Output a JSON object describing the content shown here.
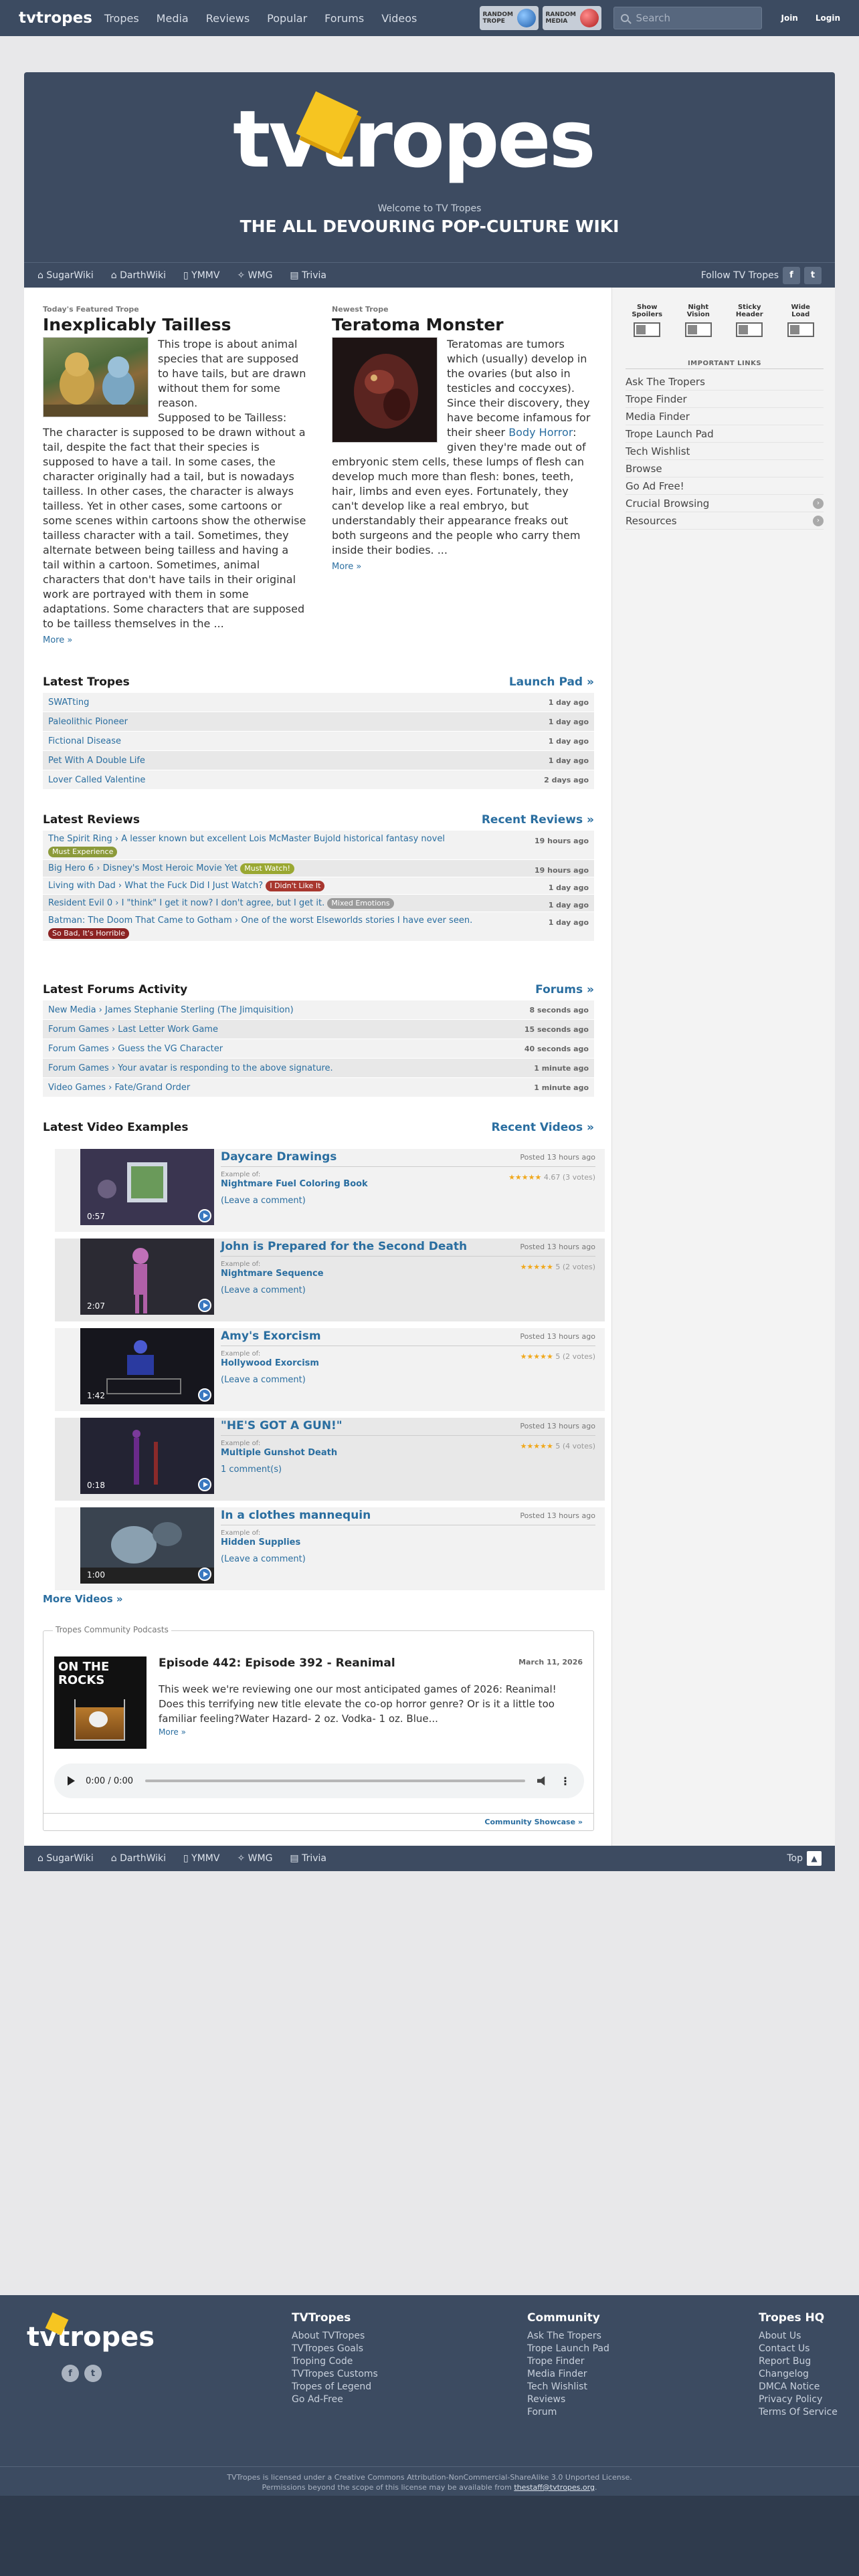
{
  "topbar": {
    "logo": "tvtropes",
    "nav": [
      "Tropes",
      "Media",
      "Reviews",
      "Popular",
      "Forums",
      "Videos"
    ],
    "random_trope": [
      "RANDOM",
      "TROPE"
    ],
    "random_media": [
      "RANDOM",
      "MEDIA"
    ],
    "search_placeholder": "Search",
    "join": "Join",
    "login": "Login"
  },
  "hero": {
    "logo": "tvtropes",
    "welcome": "Welcome to TV Tropes",
    "slogan": "THE ALL DEVOURING POP-CULTURE WIKI"
  },
  "subnav": {
    "items": [
      "SugarWiki",
      "DarthWiki",
      "YMMV",
      "WMG",
      "Trivia"
    ],
    "follow": "Follow TV Tropes"
  },
  "featured": {
    "label": "Today's Featured Trope",
    "title": "Inexplicably Tailless",
    "text": "This trope is about animal species that are supposed to have tails, but are drawn without them for some reason.\nSupposed to be Tailless: The character is supposed to be drawn without a tail, despite the fact that their species is supposed to have a tail. In some cases, the character originally had a tail, but is nowadays tailless. In other cases, the character is always tailless. Yet in other cases, some cartoons or some scenes within cartoons show the otherwise tailless character with a tail. Sometimes, they alternate between being tailless and having a tail within a cartoon. Sometimes, animal characters that don't have tails in their original work are portrayed with them in some adaptations. Some characters that are supposed to be tailless themselves in the ...",
    "more": "More »"
  },
  "newest": {
    "label": "Newest Trope",
    "title": "Teratoma Monster",
    "text_before": "Teratomas are tumors which (usually) develop in the ovaries (but also in testicles and coccyxes). Since their discovery, they have become infamous for their sheer ",
    "link": "Body Horror",
    "text_after": ": given they're made out of embryonic stem cells, these lumps of flesh can develop much more than flesh: bones, teeth, hair, limbs and even eyes. Fortunately, they can't develop like a real embryo, but understandably their appearance freaks out both surgeons and the people who carry them inside their bodies. ...",
    "more": "More »"
  },
  "latest_tropes": {
    "heading": "Latest Tropes",
    "link": "Launch Pad »",
    "rows": [
      {
        "name": "SWATting",
        "time": "1 day ago"
      },
      {
        "name": "Paleolithic Pioneer",
        "time": "1 day ago"
      },
      {
        "name": "Fictional Disease",
        "time": "1 day ago"
      },
      {
        "name": "Pet With A Double Life",
        "time": "1 day ago"
      },
      {
        "name": "Lover Called Valentine",
        "time": "2 days ago"
      }
    ]
  },
  "latest_reviews": {
    "heading": "Latest Reviews",
    "link": "Recent Reviews »",
    "rows": [
      {
        "work": "The Spirit Ring ›",
        "title": "A lesser known but excellent Lois McMaster Bujold historical fantasy novel",
        "tag": "Must Experience",
        "tag_color": "#8c9a3a",
        "time": "19 hours ago"
      },
      {
        "work": "Big Hero 6 ›",
        "title": "Disney's Most Heroic Movie Yet",
        "tag": "Must Watch!",
        "tag_color": "#9aa832",
        "time": "19 hours ago"
      },
      {
        "work": "Living with Dad ›",
        "title": "What the Fuck Did I Just Watch?",
        "tag": "I Didn't Like It",
        "tag_color": "#a8372f",
        "time": "1 day ago"
      },
      {
        "work": "Resident Evil 0 ›",
        "title": "I \"think\" I get it now? I don't agree, but I get it.",
        "tag": "Mixed Emotions",
        "tag_color": "#9a9a9a",
        "time": "1 day ago"
      },
      {
        "work": "Batman: The Doom That Came to Gotham ›",
        "title": "One of the worst Elseworlds stories I have ever seen.",
        "tag": "So Bad, It's Horrible",
        "tag_color": "#8c2323",
        "time": "1 day ago"
      }
    ]
  },
  "latest_forums": {
    "heading": "Latest Forums Activity",
    "link": "Forums »",
    "rows": [
      {
        "forum": "New Media ›",
        "topic": "James Stephanie Sterling (The Jimquisition)",
        "time": "8 seconds ago"
      },
      {
        "forum": "Forum Games ›",
        "topic": "Last Letter Work Game",
        "time": "15 seconds ago"
      },
      {
        "forum": "Forum Games ›",
        "topic": "Guess the VG Character",
        "time": "40 seconds ago"
      },
      {
        "forum": "Forum Games ›",
        "topic": "Your avatar is responding to the above signature.",
        "time": "1 minute ago"
      },
      {
        "forum": "Video Games ›",
        "topic": "Fate/Grand Order",
        "time": "1 minute ago"
      }
    ]
  },
  "latest_videos": {
    "heading": "Latest Video Examples",
    "link": "Recent Videos »",
    "example_of": "Example of:",
    "items": [
      {
        "title": "Daycare Drawings",
        "posted": "Posted 13 hours ago",
        "duration": "0:57",
        "trope": "Nightmare Fuel Coloring Book",
        "rating": "4.67 (3 votes)",
        "comments": "(Leave a comment)",
        "thumb_color": "#3a3550"
      },
      {
        "title": "John is Prepared for the Second Death",
        "posted": "Posted 13 hours ago",
        "duration": "2:07",
        "trope": "Nightmare Sequence",
        "rating": "5 (2 votes)",
        "comments": "(Leave a comment)",
        "thumb_color": "#2b2a33"
      },
      {
        "title": "Amy's Exorcism",
        "posted": "Posted 13 hours ago",
        "duration": "1:42",
        "trope": "Hollywood Exorcism",
        "rating": "5 (2 votes)",
        "comments": "(Leave a comment)",
        "thumb_color": "#16161d"
      },
      {
        "title": "\"HE'S GOT A GUN!\"",
        "posted": "Posted 13 hours ago",
        "duration": "0:18",
        "trope": "Multiple Gunshot Death",
        "rating": "5 (4 votes)",
        "comments": "1 comment(s)",
        "thumb_color": "#232333"
      },
      {
        "title": "In a clothes mannequin",
        "posted": "Posted 13 hours ago",
        "duration": "1:00",
        "trope": "Hidden Supplies",
        "rating": "",
        "comments": "(Leave a comment)",
        "thumb_color": "#3a4450"
      }
    ],
    "more": "More Videos »"
  },
  "podcast": {
    "section": "Tropes Community Podcasts",
    "art_text": "ON THE ROCKS",
    "episode": "Episode 442: Episode 392 - Reanimal",
    "date": "March 11, 2026",
    "desc": "This week we're reviewing one our most anticipated games of 2026: Reanimal! Does this terrifying new title elevate the co-op horror genre? Or is it a little too familiar feeling?Water Hazard- 2 oz. Vodka- 1 oz. Blue...",
    "more": "More »",
    "time": "0:00 / 0:00",
    "showcase": "Community Showcase »"
  },
  "sidebar": {
    "toggles": [
      {
        "label1": "Show",
        "label2": "Spoilers"
      },
      {
        "label1": "Night",
        "label2": "Vision"
      },
      {
        "label1": "Sticky",
        "label2": "Header"
      },
      {
        "label1": "Wide",
        "label2": "Load"
      }
    ],
    "important_heading": "IMPORTANT LINKS",
    "links": [
      "Ask The Tropers",
      "Trope Finder",
      "Media Finder",
      "Trope Launch Pad",
      "Tech Wishlist",
      "Browse",
      "Go Ad Free!",
      "Crucial Browsing",
      "Resources"
    ]
  },
  "bottom_nav": {
    "items": [
      "SugarWiki",
      "DarthWiki",
      "YMMV",
      "WMG",
      "Trivia"
    ],
    "top": "Top"
  },
  "footer": {
    "logo": "tvtropes",
    "social": [
      "f",
      "t"
    ],
    "cols": [
      {
        "heading": "TVTropes",
        "links": [
          "About TVTropes",
          "TVTropes Goals",
          "Troping Code",
          "TVTropes Customs",
          "Tropes of Legend",
          "Go Ad-Free"
        ]
      },
      {
        "heading": "Community",
        "links": [
          "Ask The Tropers",
          "Trope Launch Pad",
          "Trope Finder",
          "Media Finder",
          "Tech Wishlist",
          "Reviews",
          "Forum"
        ]
      },
      {
        "heading": "Tropes HQ",
        "links": [
          "About Us",
          "Contact Us",
          "Report Bug",
          "Changelog",
          "DMCA Notice",
          "Privacy Policy",
          "Terms Of Service"
        ]
      }
    ],
    "license1": "TVTropes is licensed under a Creative Commons Attribution-NonCommercial-ShareAlike 3.0 Unported License.",
    "license2": "Permissions beyond the scope of this license may be available from",
    "license_email": "thestaff@tvtropes.org",
    "license_end": "."
  },
  "colors": {
    "brand": "#3c4b61",
    "accent": "#f6c521",
    "link": "#2a6ea0"
  }
}
